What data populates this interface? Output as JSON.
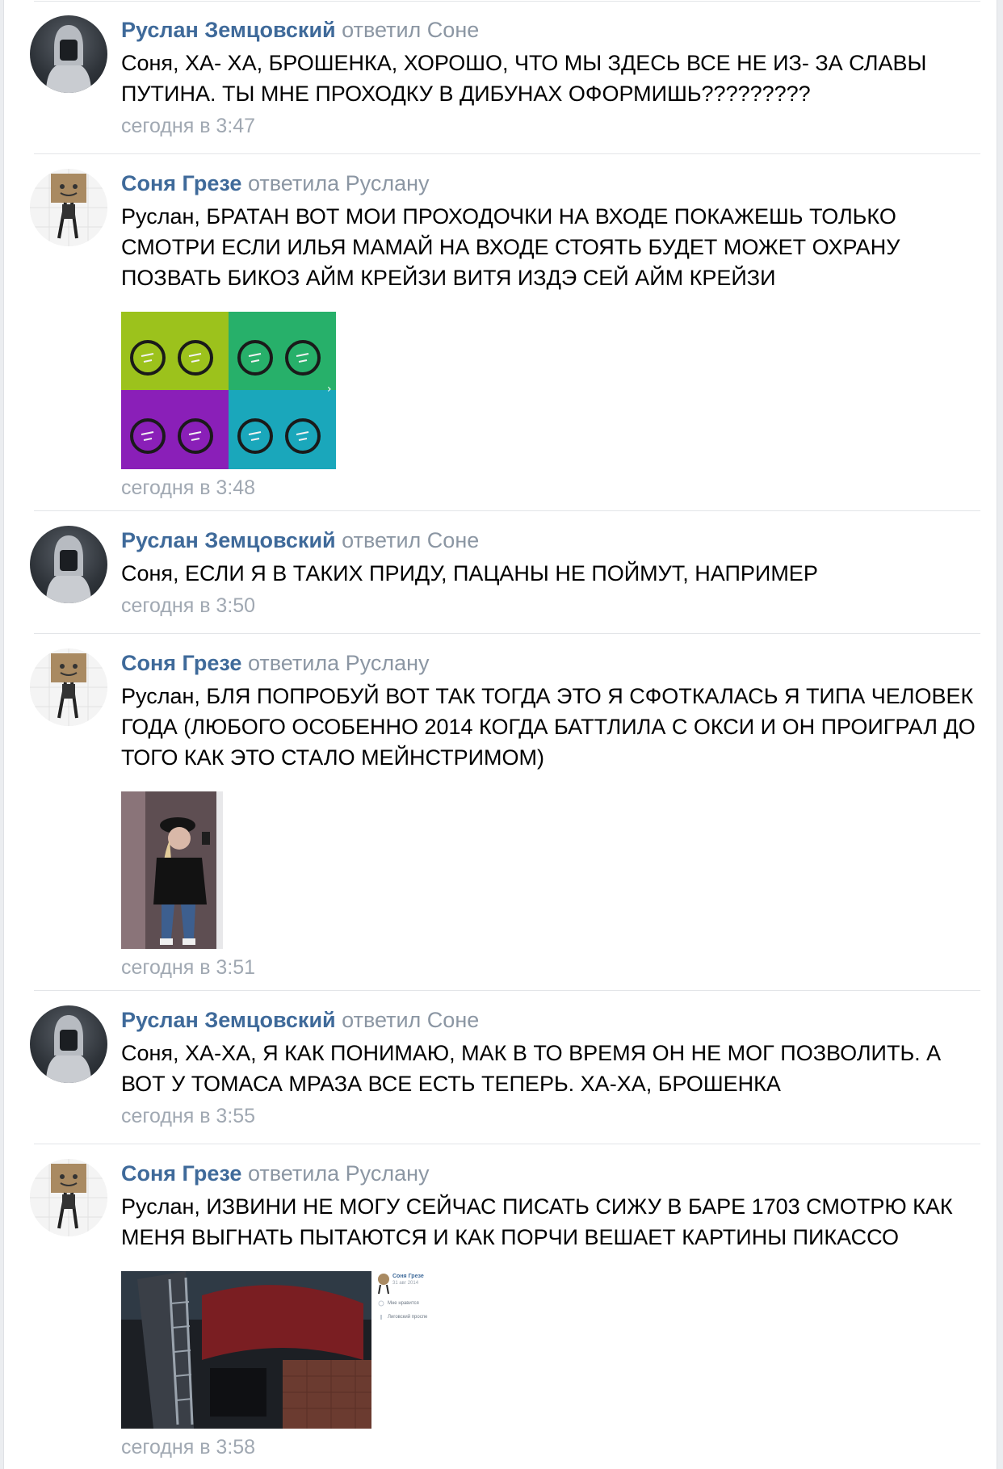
{
  "comments": [
    {
      "author": "Руслан Земцовский",
      "reply_to": "ответил Соне",
      "text": "Соня, ХА- ХА, БРОШЕНКА, ХОРОШО, ЧТО МЫ ЗДЕСЬ ВСЕ НЕ ИЗ- ЗА СЛАВЫ ПУТИНА. ТЫ МНЕ ПРОХОДКУ В ДИБУНАХ ОФОРМИШЬ?????????",
      "time": "сегодня в 3:47"
    },
    {
      "author": "Соня Грезе",
      "reply_to": "ответила Руслану",
      "text": "Руслан, БРАТАН ВОТ МОИ ПРОХОДОЧКИ НА ВХОДЕ ПОКАЖЕШЬ ТОЛЬКО СМОТРИ ЕСЛИ ИЛЬЯ МАМАЙ НА ВХОДЕ СТОЯТЬ БУДЕТ МОЖЕТ ОХРАНУ ПОЗВАТЬ БИКОЗ АЙМ КРЕЙЗИ ВИТЯ ИЗДЭ СЕЙ АЙМ КРЕЙЗИ",
      "time": "сегодня в 3:48",
      "attachment": "pop-art-grid-photo"
    },
    {
      "author": "Руслан Земцовский",
      "reply_to": "ответил Соне",
      "text": "Соня, ЕСЛИ Я В ТАКИХ ПРИДУ, ПАЦАНЫ НЕ ПОЙМУТ, НАПРИМЕР",
      "time": "сегодня в 3:50"
    },
    {
      "author": "Соня Грезе",
      "reply_to": "ответила Руслану",
      "text": "Руслан, БЛЯ ПОПРОБУЙ ВОТ ТАК ТОГДА ЭТО Я СФОТКАЛАСЬ Я ТИПА ЧЕЛОВЕК ГОДА (ЛЮБОГО ОСОБЕННО 2014 КОГДА БАТТЛИЛА С ОКСИ И ОН ПРОИГРАЛ ДО ТОГО КАК ЭТО СТАЛО МЕЙНСТРИМОМ)",
      "time": "сегодня в 3:51",
      "attachment": "mirror-selfie-photo"
    },
    {
      "author": "Руслан Земцовский",
      "reply_to": "ответил Соне",
      "text": "Соня, ХА-ХА, Я КАК ПОНИМАЮ, МАК В ТО ВРЕМЯ ОН НЕ МОГ ПОЗВОЛИТЬ. А ВОТ У ТОМАСА МРАЗА ВСЕ ЕСТЬ ТЕПЕРЬ. ХА-ХА, БРОШЕНКА",
      "time": "сегодня в 3:55"
    },
    {
      "author": "Соня Грезе",
      "reply_to": "ответила Руслану",
      "text": "Руслан, ИЗВИНИ НЕ МОГУ СЕЙЧАС ПИСАТЬ СИЖУ В БАРЕ 1703 СМОТРЮ КАК МЕНЯ ВЫГНАТЬ ПЫТАЮТСЯ И КАК ПОРЧИ ВЕШАЕТ КАРТИНЫ ПИКАССО",
      "time": "сегодня в 3:58",
      "attachment": "bar-post-screenshot",
      "mini_post": {
        "author": "Соня Грезе",
        "date": "31 авг 2014",
        "likes": "Мне нравится",
        "place": "Лиговский проспе"
      }
    }
  ],
  "colors": {
    "author": "#3f6a9a",
    "meta": "#8b96a3",
    "time": "#a0a8b2",
    "text": "#000000"
  }
}
